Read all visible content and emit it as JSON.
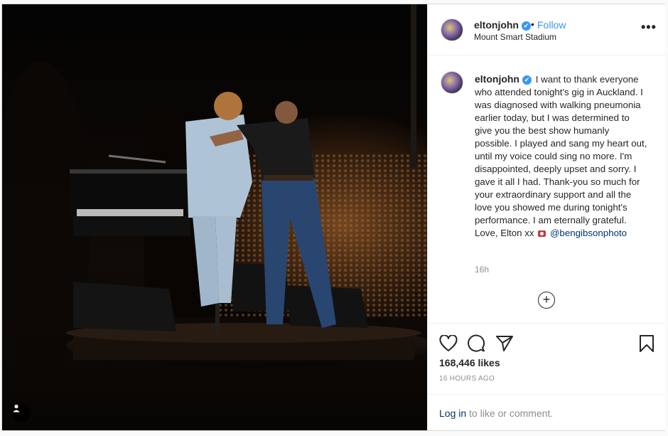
{
  "post": {
    "username": "eltonjohn",
    "verified_mark": "✔",
    "separator": "•",
    "follow_label": "Follow",
    "location": "Mount Smart Stadium",
    "more_label": "•••",
    "caption": "I want to thank everyone who attended tonight's gig in Auckland. I was diagnosed with walking pneumonia earlier today, but I was determined to give you the best show humanly possible. I played and sang my heart out, until my voice could sing no more. I'm disappointed, deeply upset and sorry. I gave it all I had. Thank-you so much for your extraordinary support and all the love you showed me during tonight's performance. I am eternally grateful. Love, Elton xx",
    "photo_credit": "@bengibsonphoto",
    "age": "16h",
    "load_more_label": "+",
    "likes": "168,446 likes",
    "timestamp": "16 HOURS AGO"
  },
  "login": {
    "link_label": "Log in",
    "suffix": " to like or comment."
  },
  "icons": {
    "heart": "heart-icon",
    "comment": "comment-icon",
    "share": "share-icon",
    "bookmark": "bookmark-icon",
    "user_tag": "user-tag-icon",
    "camera": "camera-emoji-icon"
  },
  "colors": {
    "link": "#3897f0",
    "dark_link": "#003569",
    "muted": "#8e8e8e",
    "border": "#efefef"
  }
}
